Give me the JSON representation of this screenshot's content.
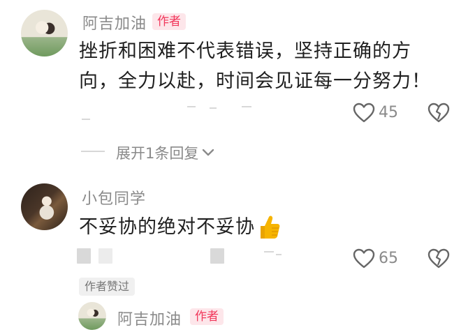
{
  "comments": [
    {
      "username": "阿吉加油",
      "badge": "作者",
      "text_line1": "挫折和困难不代表错误，坚持正确的方",
      "text_line2": "向，全力以赴，时间会见证每一分努力！",
      "likes": "45",
      "expand_label": "展开1条回复"
    },
    {
      "username": "小包同学",
      "text": "不妥协的绝对不妥协",
      "likes": "65",
      "author_liked_label": "作者赞过"
    }
  ],
  "reply_preview": {
    "username": "阿吉加油",
    "badge": "作者"
  },
  "icons": {
    "like": "heart-outline-icon",
    "dislike": "broken-heart-icon",
    "expand": "chevron-down-icon",
    "emoji": "thumbs-up-emoji"
  },
  "colors": {
    "badge_text": "#f1375b",
    "badge_bg": "#fde6ea",
    "meta_gray": "#8a8a8a",
    "thumb_yellow": "#f6b400"
  }
}
